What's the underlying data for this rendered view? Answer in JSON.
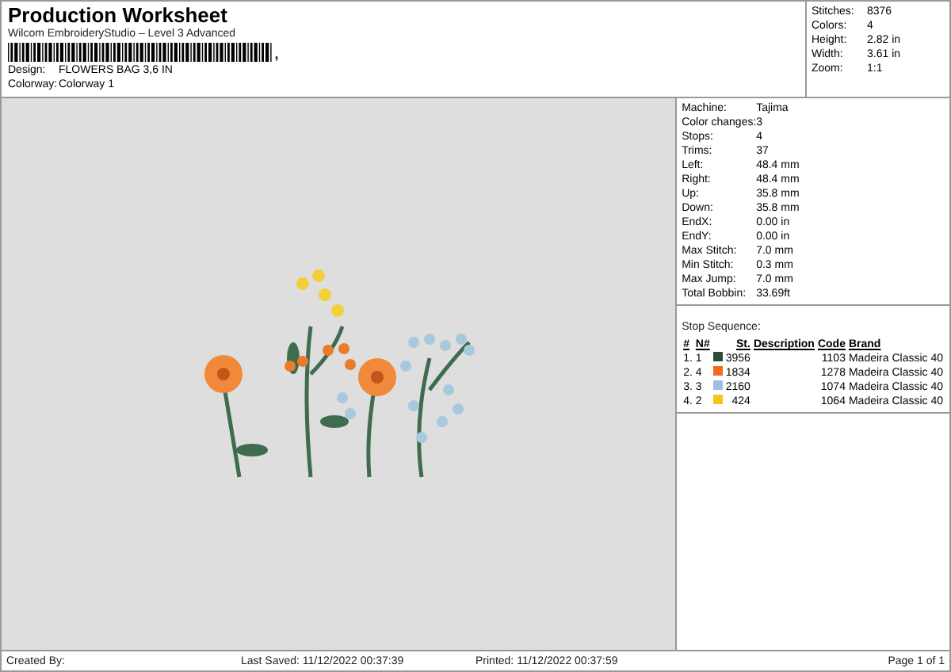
{
  "title": "Production Worksheet",
  "subtitle": "Wilcom EmbroideryStudio – Level 3 Advanced",
  "barcode_mark": ",",
  "design": [
    {
      "label": "Design:",
      "value": "FLOWERS BAG 3,6 IN"
    },
    {
      "label": "Colorway:",
      "value": "Colorway 1"
    }
  ],
  "summary": [
    {
      "label": "Stitches:",
      "value": "8376"
    },
    {
      "label": "Colors:",
      "value": "4"
    },
    {
      "label": "Height:",
      "value": "2.82 in"
    },
    {
      "label": "Width:",
      "value": "3.61 in"
    },
    {
      "label": "Zoom:",
      "value": "1:1"
    }
  ],
  "machine_info": [
    {
      "label": "Machine:",
      "value": "Tajima"
    },
    {
      "label": "Color changes:",
      "value": "3"
    },
    {
      "label": "Stops:",
      "value": "4"
    },
    {
      "label": "Trims:",
      "value": "37"
    },
    {
      "label": "Left:",
      "value": "48.4 mm"
    },
    {
      "label": "Right:",
      "value": "48.4 mm"
    },
    {
      "label": "Up:",
      "value": "35.8 mm"
    },
    {
      "label": "Down:",
      "value": "35.8 mm"
    },
    {
      "label": "EndX:",
      "value": "0.00 in"
    },
    {
      "label": "EndY:",
      "value": "0.00 in"
    },
    {
      "label": "Max Stitch:",
      "value": "7.0 mm"
    },
    {
      "label": "Min Stitch:",
      "value": "0.3 mm"
    },
    {
      "label": "Max Jump:",
      "value": "7.0 mm"
    },
    {
      "label": "Total Bobbin:",
      "value": "33.69ft"
    }
  ],
  "stop_sequence": {
    "title": "Stop Sequence:",
    "columns": [
      "#",
      "N#",
      "St.",
      "Description",
      "Code",
      "Brand"
    ],
    "rows": [
      {
        "index": "1.",
        "n": "1",
        "color": "#2f4a37",
        "stitches": "3956",
        "code": "1103",
        "brand": "Madeira Classic 40"
      },
      {
        "index": "2.",
        "n": "4",
        "color": "#f26a1b",
        "stitches": "1834",
        "code": "1278",
        "brand": "Madeira Classic 40"
      },
      {
        "index": "3.",
        "n": "3",
        "color": "#9dbfe0",
        "stitches": "2160",
        "code": "1074",
        "brand": "Madeira Classic 40"
      },
      {
        "index": "4.",
        "n": "2",
        "color": "#f5c518",
        "stitches": "424",
        "code": "1064",
        "brand": "Madeira Classic 40"
      }
    ]
  },
  "footer": {
    "created_by": "Created By:",
    "last_saved": "Last Saved: 11/12/2022 00:37:39",
    "printed": "Printed: 11/12/2022 00:37:59",
    "page": "Page 1 of 1"
  }
}
